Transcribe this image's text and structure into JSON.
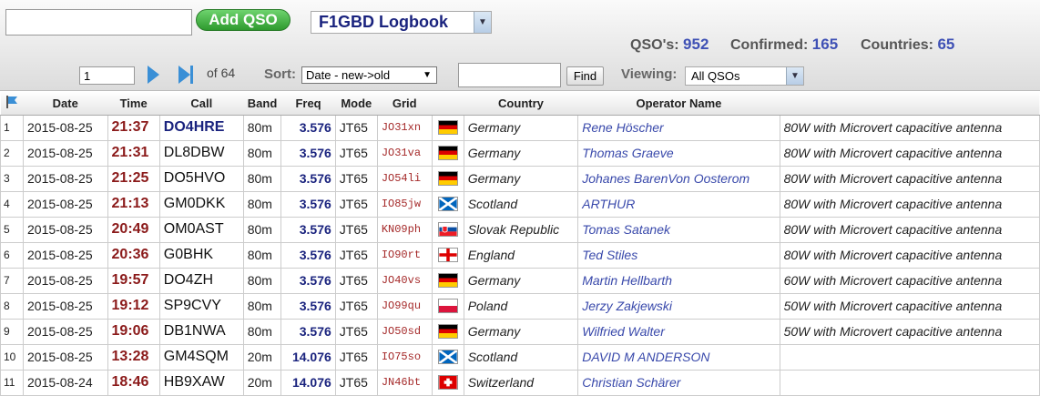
{
  "toolbar": {
    "search_value": "",
    "add_label": "Add QSO",
    "logbook": "F1GBD Logbook",
    "stats": {
      "qsos_label": "QSO's:",
      "qsos": "952",
      "confirmed_label": "Confirmed:",
      "confirmed": "165",
      "countries_label": "Countries:",
      "countries": "65"
    },
    "page_value": "1",
    "page_of": "of 64",
    "sort_label": "Sort:",
    "sort_value": "Date - new->old",
    "find_value": "",
    "find_label": "Find",
    "viewing_label": "Viewing:",
    "viewing_value": "All QSOs"
  },
  "columns": [
    "Date",
    "Time",
    "Call",
    "Band",
    "Freq",
    "Mode",
    "Grid",
    "Country",
    "Operator Name"
  ],
  "rows": [
    {
      "n": "1",
      "date": "2015-08-25",
      "time": "21:37",
      "call": "DO4HRE",
      "band": "80m",
      "freq": "3.576",
      "mode": "JT65",
      "grid": "JO31xn",
      "flag": "de",
      "country": "Germany",
      "op": "Rene Höscher",
      "note": "80W with Microvert capacitive antenna"
    },
    {
      "n": "2",
      "date": "2015-08-25",
      "time": "21:31",
      "call": "DL8DBW",
      "band": "80m",
      "freq": "3.576",
      "mode": "JT65",
      "grid": "JO31va",
      "flag": "de",
      "country": "Germany",
      "op": "Thomas Graeve",
      "note": "80W with Microvert capacitive antenna"
    },
    {
      "n": "3",
      "date": "2015-08-25",
      "time": "21:25",
      "call": "DO5HVO",
      "band": "80m",
      "freq": "3.576",
      "mode": "JT65",
      "grid": "JO54li",
      "flag": "de",
      "country": "Germany",
      "op": "Johanes BarenVon Oosterom",
      "note": "80W with Microvert capacitive antenna"
    },
    {
      "n": "4",
      "date": "2015-08-25",
      "time": "21:13",
      "call": "GM0DKK",
      "band": "80m",
      "freq": "3.576",
      "mode": "JT65",
      "grid": "IO85jw",
      "flag": "sco",
      "country": "Scotland",
      "op": "ARTHUR",
      "note": "80W with Microvert capacitive antenna"
    },
    {
      "n": "5",
      "date": "2015-08-25",
      "time": "20:49",
      "call": "OM0AST",
      "band": "80m",
      "freq": "3.576",
      "mode": "JT65",
      "grid": "KN09ph",
      "flag": "sk",
      "country": "Slovak Republic",
      "op": "Tomas Satanek",
      "note": "80W with Microvert capacitive antenna"
    },
    {
      "n": "6",
      "date": "2015-08-25",
      "time": "20:36",
      "call": "G0BHK",
      "band": "80m",
      "freq": "3.576",
      "mode": "JT65",
      "grid": "IO90rt",
      "flag": "eng",
      "country": "England",
      "op": "Ted Stiles",
      "note": "80W with Microvert capacitive antenna"
    },
    {
      "n": "7",
      "date": "2015-08-25",
      "time": "19:57",
      "call": "DO4ZH",
      "band": "80m",
      "freq": "3.576",
      "mode": "JT65",
      "grid": "JO40vs",
      "flag": "de",
      "country": "Germany",
      "op": "Martin Hellbarth",
      "note": "60W with Microvert capacitive antenna"
    },
    {
      "n": "8",
      "date": "2015-08-25",
      "time": "19:12",
      "call": "SP9CVY",
      "band": "80m",
      "freq": "3.576",
      "mode": "JT65",
      "grid": "JO99qu",
      "flag": "pl",
      "country": "Poland",
      "op": "Jerzy Zakjewski",
      "note": "50W with Microvert capacitive antenna"
    },
    {
      "n": "9",
      "date": "2015-08-25",
      "time": "19:06",
      "call": "DB1NWA",
      "band": "80m",
      "freq": "3.576",
      "mode": "JT65",
      "grid": "JO50sd",
      "flag": "de",
      "country": "Germany",
      "op": "Wilfried Walter",
      "note": "50W with Microvert capacitive antenna"
    },
    {
      "n": "10",
      "date": "2015-08-25",
      "time": "13:28",
      "call": "GM4SQM",
      "band": "20m",
      "freq": "14.076",
      "mode": "JT65",
      "grid": "IO75so",
      "flag": "sco",
      "country": "Scotland",
      "op": "DAVID M ANDERSON",
      "note": ""
    },
    {
      "n": "11",
      "date": "2015-08-24",
      "time": "18:46",
      "call": "HB9XAW",
      "band": "20m",
      "freq": "14.076",
      "mode": "JT65",
      "grid": "JN46bt",
      "flag": "ch",
      "country": "Switzerland",
      "op": "Christian Schärer",
      "note": ""
    }
  ]
}
